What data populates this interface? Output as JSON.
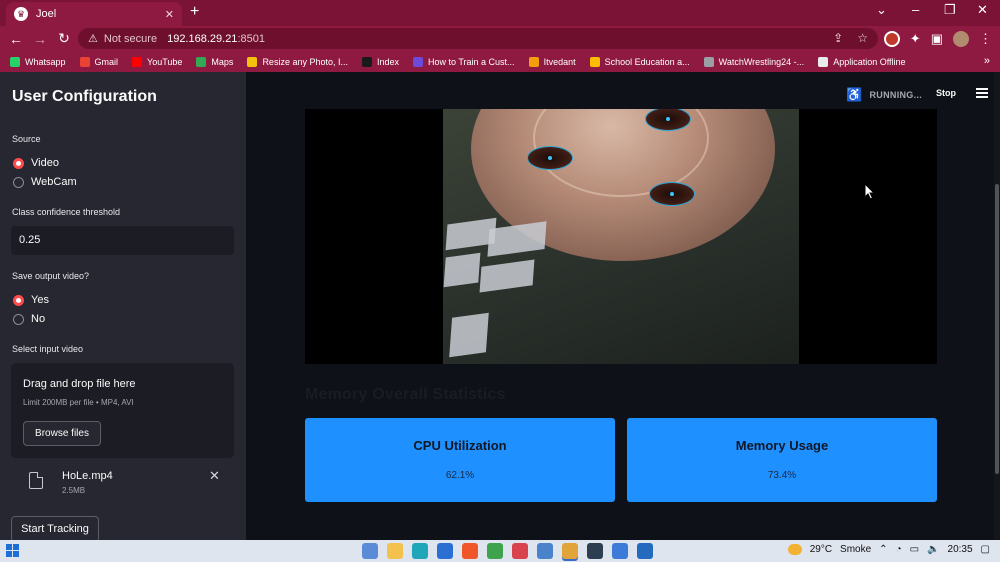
{
  "browser": {
    "tab_title": "Joel",
    "tab_icon": "streamlit-icon",
    "security_label": "Not secure",
    "url_host": "192.168.29.21",
    "url_port": ":8501",
    "bookmarks": [
      {
        "label": "Whatsapp",
        "color": "#25d366"
      },
      {
        "label": "Gmail",
        "color": "#ea4335"
      },
      {
        "label": "YouTube",
        "color": "#ff0000"
      },
      {
        "label": "Maps",
        "color": "#34a853"
      },
      {
        "label": "Resize any Photo, I...",
        "color": "#f4c20d"
      },
      {
        "label": "Index",
        "color": "#1a1a1a"
      },
      {
        "label": "How to Train a Cust...",
        "color": "#6c4bd8"
      },
      {
        "label": "Itvedant",
        "color": "#f59e0b"
      },
      {
        "label": "School Education a...",
        "color": "#fbbc04"
      },
      {
        "label": "WatchWrestling24 -...",
        "color": "#9aa0a6"
      },
      {
        "label": "Application Offline",
        "color": "#e8eaed"
      }
    ]
  },
  "sidebar": {
    "title": "User Configuration",
    "source_label": "Source",
    "source_options": [
      "Video",
      "WebCam"
    ],
    "source_selected": "Video",
    "threshold_label": "Class confidence threshold",
    "threshold_value": "0.25",
    "save_label": "Save output video?",
    "save_options": [
      "Yes",
      "No"
    ],
    "save_selected": "Yes",
    "input_label": "Select input video",
    "dropzone_title": "Drag and drop file here",
    "dropzone_sub": "Limit 200MB per file • MP4, AVI",
    "browse_label": "Browse files",
    "file_name": "HoLe.mp4",
    "file_size": "2.5MB",
    "start_label": "Start Tracking"
  },
  "main": {
    "status_text": "RUNNING...",
    "stop_label": "Stop",
    "section_title": "Memory Overall Statistics",
    "metrics": [
      {
        "title": "CPU Utilization",
        "value": "62.1%"
      },
      {
        "title": "Memory Usage",
        "value": "73.4%"
      }
    ]
  },
  "taskbar": {
    "weather": "29°C",
    "weather_desc": "Smoke",
    "time": "20:35"
  },
  "colors": {
    "browser_accent": "#8e1a42",
    "streamlit_red": "#ff4b4b",
    "metric_blue": "#1e90ff",
    "detection_box": "#2aa4d8"
  }
}
